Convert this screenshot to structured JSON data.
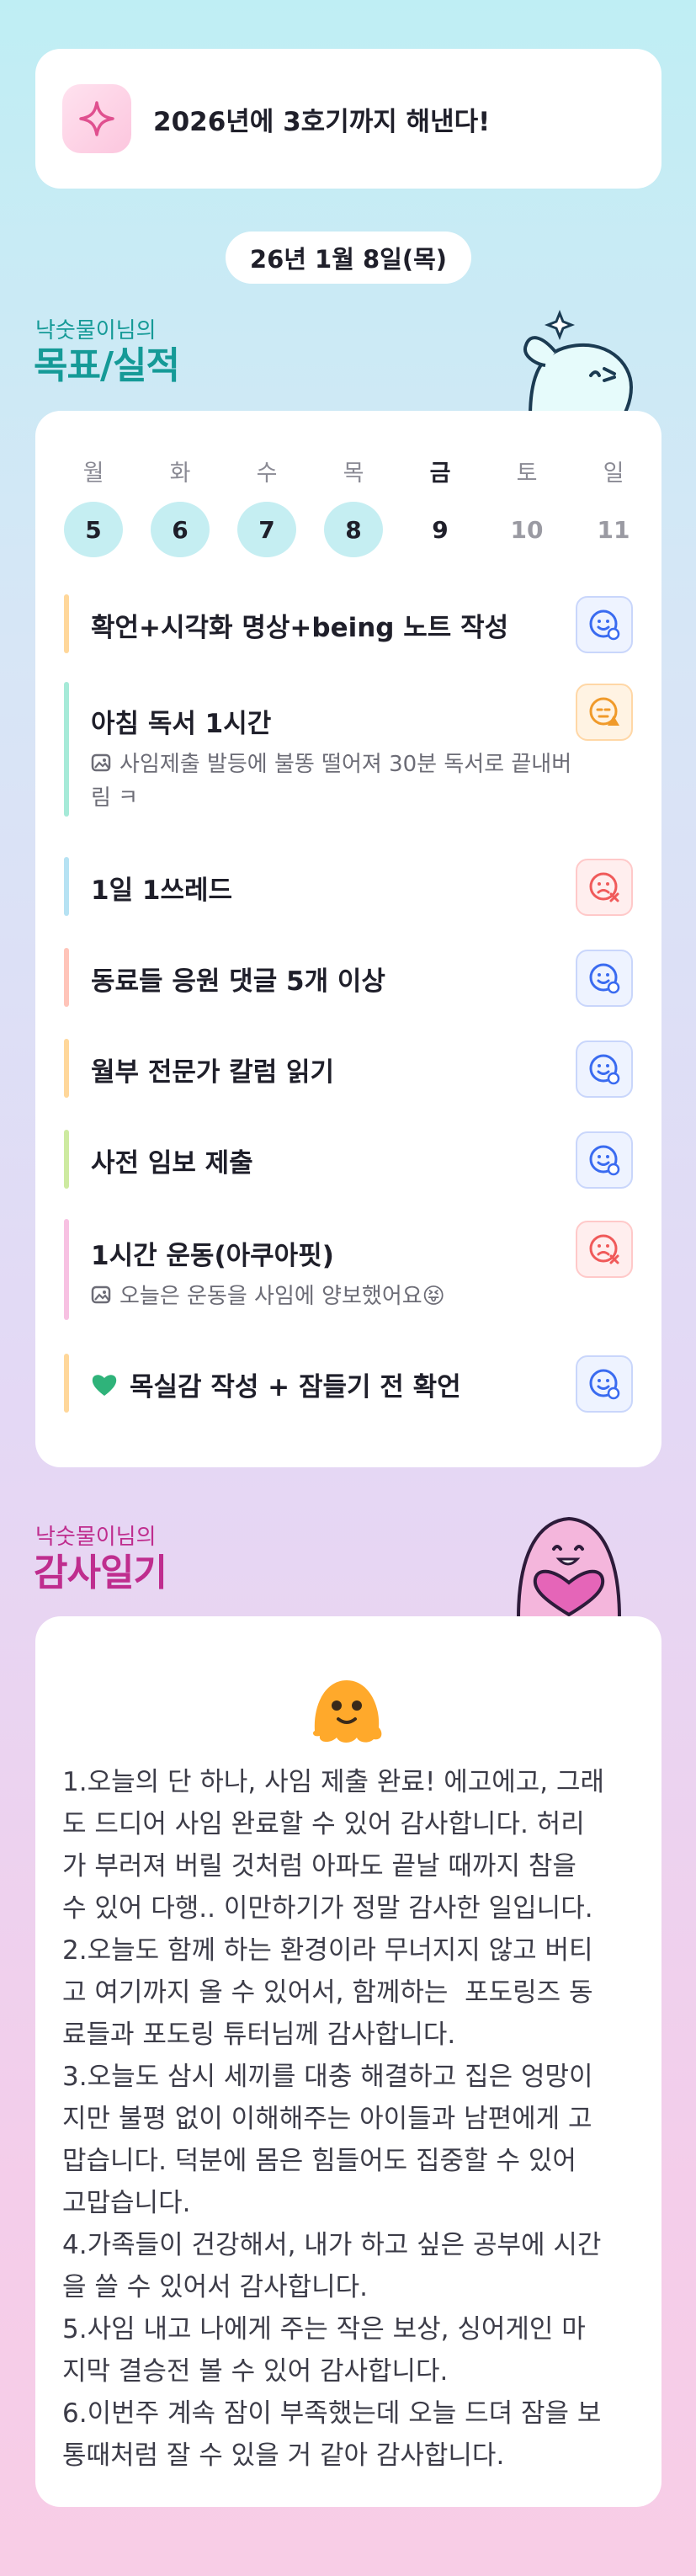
{
  "goal_banner": {
    "text": "2026년에 3호기까지 해낸다!",
    "icon": "sparkle-icon"
  },
  "date": "26년 1월 8일(목)",
  "goals_section": {
    "owner_label": "낙숫물이님의",
    "title": "목표/실적"
  },
  "week": [
    {
      "label": "월",
      "num": "5",
      "state": "done"
    },
    {
      "label": "화",
      "num": "6",
      "state": "done"
    },
    {
      "label": "수",
      "num": "7",
      "state": "done"
    },
    {
      "label": "목",
      "num": "8",
      "state": "done"
    },
    {
      "label": "금",
      "num": "9",
      "state": "today"
    },
    {
      "label": "토",
      "num": "10",
      "state": "future"
    },
    {
      "label": "일",
      "num": "11",
      "state": "future"
    }
  ],
  "goals": [
    {
      "title": "확언+시각화 명상+being 노트 작성",
      "note": "",
      "status": "smile",
      "bar_color": "#ffd79a"
    },
    {
      "title": "아침 독서 1시간",
      "note": "사임제출 발등에 불똥 떨어져 30분 독서로 끝내버\n림 ㅋ",
      "status": "warning",
      "bar_color": "#a6ead8"
    },
    {
      "title": "1일 1쓰레드",
      "note": "",
      "status": "fail",
      "bar_color": "#b6e2f3"
    },
    {
      "title": "동료들 응원 댓글 5개 이상",
      "note": "",
      "status": "smile",
      "bar_color": "#ffc4b9"
    },
    {
      "title": "월부 전문가 칼럼 읽기",
      "note": "",
      "status": "smile",
      "bar_color": "#ffd79a"
    },
    {
      "title": "사전 임보 제출",
      "note": "",
      "status": "smile",
      "bar_color": "#cdeaa0"
    },
    {
      "title": "1시간 운동(아쿠아핏)",
      "note": "오늘은 운동을 사임에 양보했어요😝",
      "status": "fail",
      "bar_color": "#f7c1e2"
    },
    {
      "title": "목실감 작성 + 잠들기 전 확언",
      "note": "",
      "status": "smile",
      "bar_color": "#ffd79a",
      "prefix_icon": "green-heart-icon"
    }
  ],
  "diary_section": {
    "owner_label": "낙숫물이님의",
    "title": "감사일기"
  },
  "diary_text": "1.오늘의 단 하나, 사임 제출 완료! 에고에고, 그래\n도 드디어 사임 완료할 수 있어 감사합니다. 허리\n가 부러져 버릴 것처럼 아파도 끝날 때까지 참을\n수 있어 다행.. 이만하기가 정말 감사한 일입니다.\n2.오늘도 함께 하는 환경이라 무너지지 않고 버티\n고 여기까지 올 수 있어서, 함께하는  포도링즈 동\n료들과 포도링 튜터님께 감사합니다.\n3.오늘도 삼시 세끼를 대충 해결하고 집은 엉망이\n지만 불평 없이 이해해주는 아이들과 남편에게 고\n맙습니다. 덕분에 몸은 힘들어도 집중할 수 있어\n고맙습니다.\n4.가족들이 건강해서, 내가 하고 싶은 공부에 시간\n을 쓸 수 있어서 감사합니다.\n5.사임 내고 나에게 주는 작은 보상, 싱어게인 마\n지막 결승전 볼 수 있어 감사합니다.\n6.이번주 계속 잠이 부족했는데 오늘 드뎌 잠을 보\n통때처럼 잘 수 있을 거 같아 감사합니다.",
  "colors": {
    "accent_teal": "#159a97",
    "accent_magenta": "#bf2d8e",
    "done_day": "#c5eef2"
  }
}
